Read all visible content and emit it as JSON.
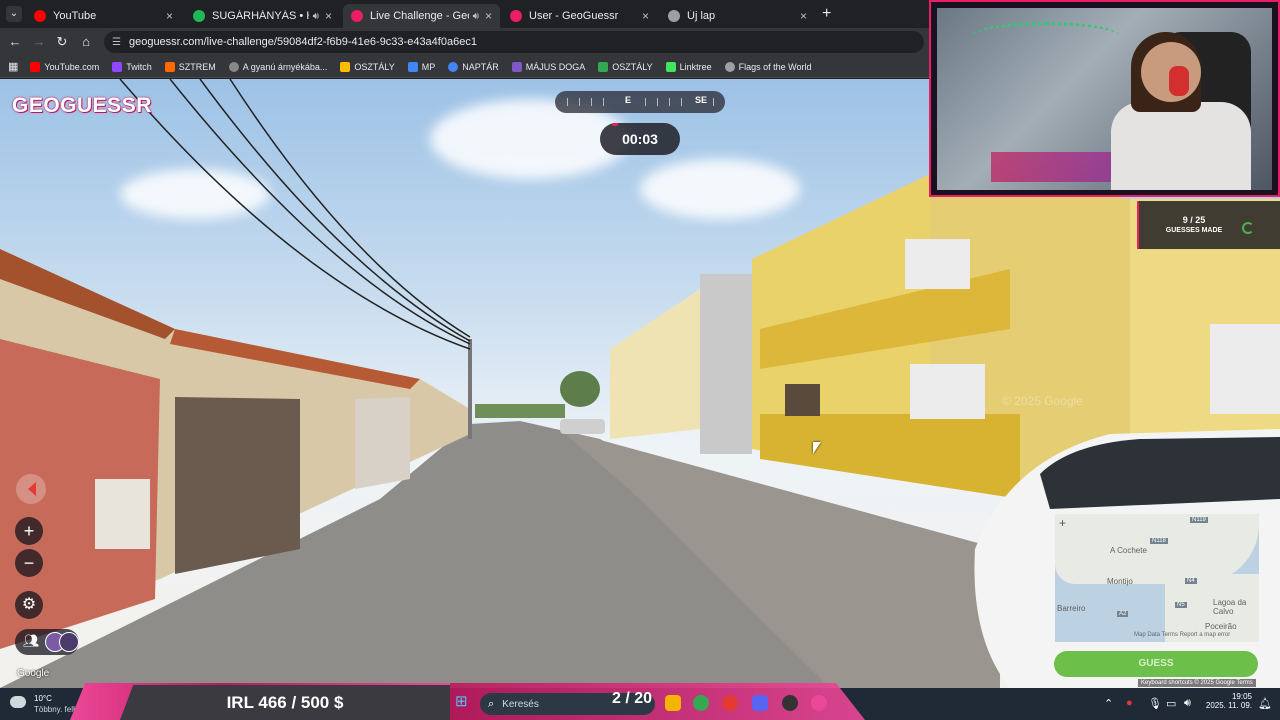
{
  "browser": {
    "tabs": [
      {
        "title": "YouTube",
        "fav": "#ff0000",
        "sound": false
      },
      {
        "title": "SUGÁRHÁNYÁS • Hűvös",
        "fav": "#1db954",
        "sound": true
      },
      {
        "title": "Live Challenge - GeoGuessr",
        "fav": "#e91e63",
        "sound": true,
        "active": true
      },
      {
        "title": "User - GeoGuessr",
        "fav": "#e91e63",
        "sound": false
      },
      {
        "title": "Új lap",
        "fav": "#9aa0a6",
        "sound": false
      }
    ],
    "url": "geoguessr.com/live-challenge/59084df2-f6b9-41e6-9c33-e43a4f0a6ec1",
    "bookmarks": [
      {
        "label": "YouTube.com",
        "color": "#ff0000"
      },
      {
        "label": "Twitch",
        "color": "#9146ff"
      },
      {
        "label": "SZTREM",
        "color": "#ff6a00"
      },
      {
        "label": "A gyanú árnyékába...",
        "color": "#888888"
      },
      {
        "label": "OSZTÁLY",
        "color": "#fbbc04"
      },
      {
        "label": "MP",
        "color": "#4285f4"
      },
      {
        "label": "NAPTÁR",
        "color": "#4285f4"
      },
      {
        "label": "MÁJUS DOGA",
        "color": "#7e57c2"
      },
      {
        "label": "OSZTÁLY",
        "color": "#34a853"
      },
      {
        "label": "Linktree",
        "color": "#43e55e"
      },
      {
        "label": "Flags of the World",
        "color": "#9aa0a6"
      }
    ]
  },
  "game": {
    "logo": "GEOGUESSR",
    "compass": {
      "e": "E",
      "se": "SE"
    },
    "timer": "00:03",
    "zoom_in": "+",
    "zoom_out": "−",
    "google_mark": "Google",
    "watermark": "© 2025 Google",
    "guess_button": "GUESS",
    "map_footer": "Keyboard shortcuts   © 2025 Google   Terms",
    "map_labels": {
      "a": "A Cochete",
      "b": "Montijo",
      "c": "Barreiro",
      "d": "Lagoa da Calvo",
      "e": "Poceirão",
      "s1": "N119",
      "s2": "N118",
      "s3": "N4",
      "s4": "N5",
      "s5": "A2"
    },
    "map_attrib": "Map Data   Terms   Report a map error"
  },
  "stream": {
    "guesses_count": "9 / 25",
    "guesses_label": "GUESSES MADE",
    "irl": "IRL  466 / 500 $",
    "round": "2 / 20"
  },
  "taskbar": {
    "temp": "10°C",
    "weather": "Többny. felhős",
    "search_placeholder": "Keresés",
    "time": "19:05",
    "date": "2025. 11. 09."
  }
}
